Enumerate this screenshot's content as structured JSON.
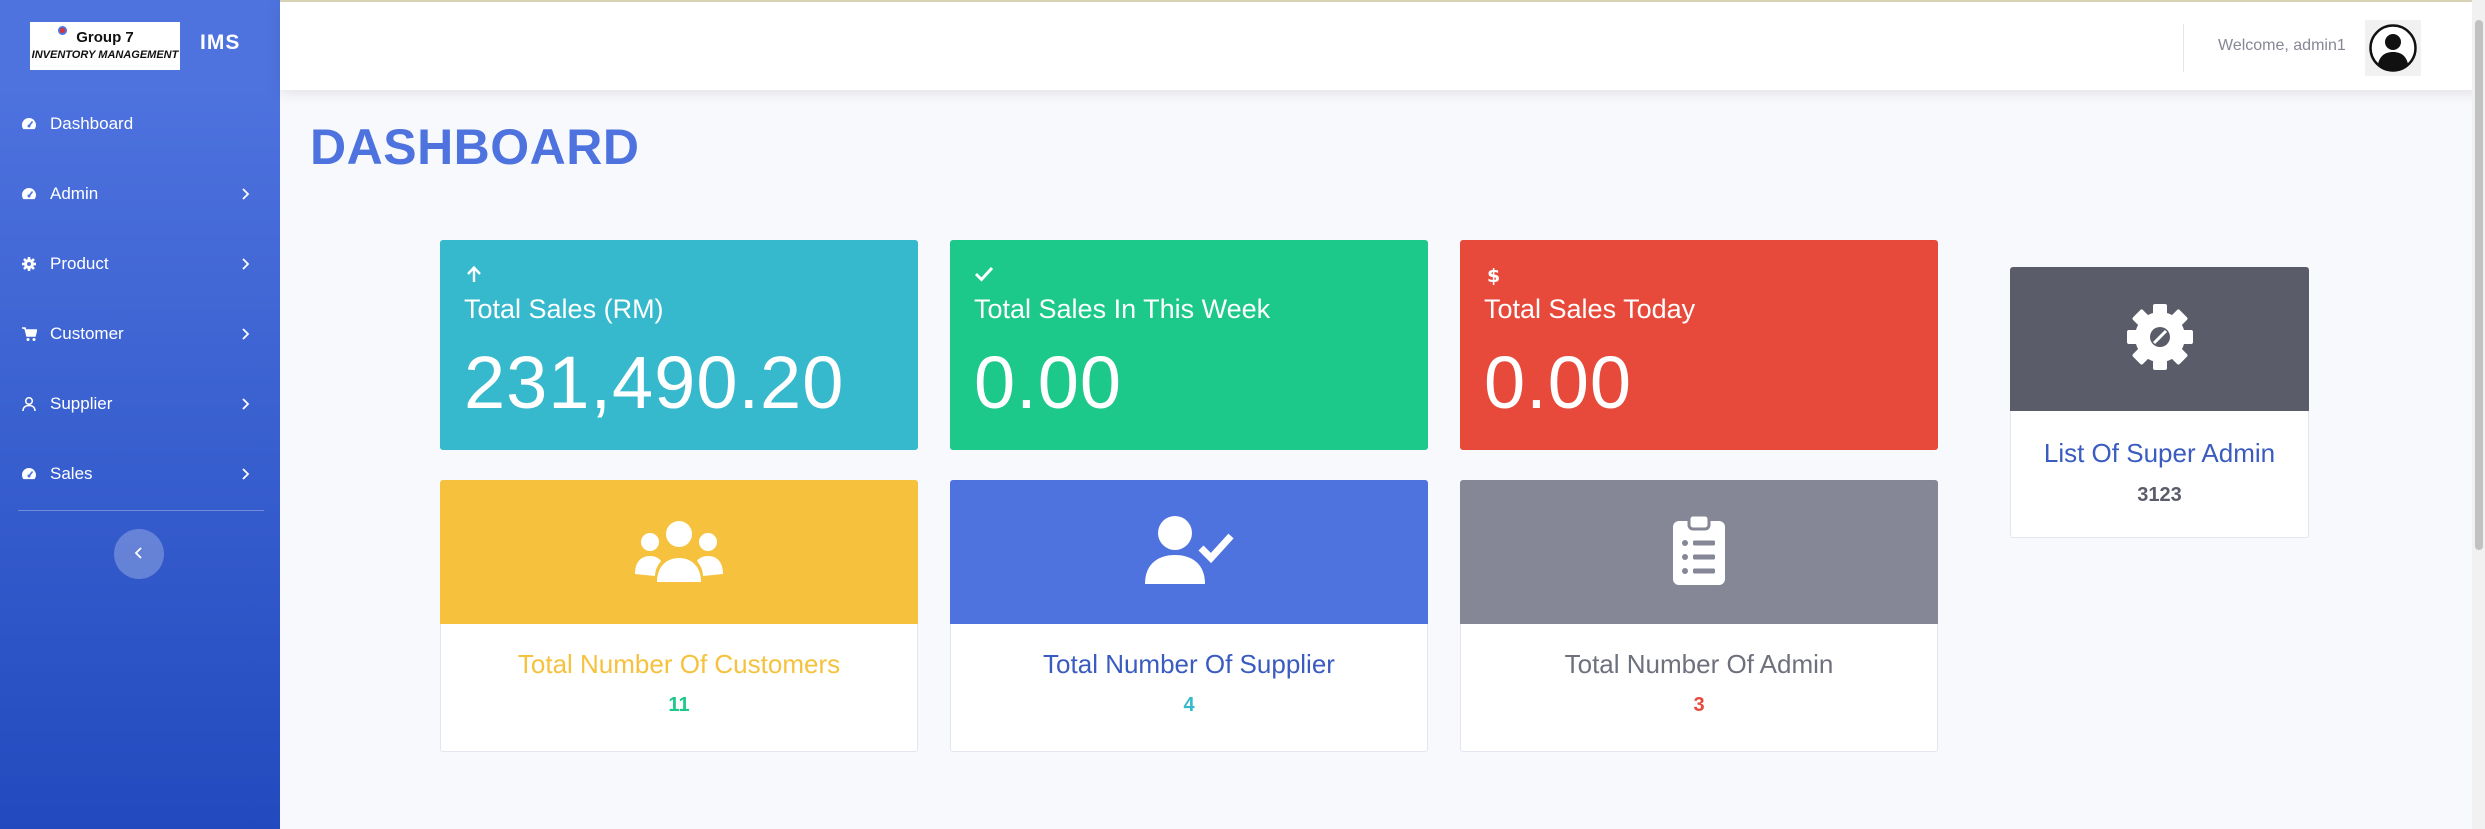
{
  "brand": {
    "logo_line1": "Group 7",
    "logo_line2": "INVENTORY MANAGEMENT",
    "app_name": "IMS"
  },
  "sidebar": {
    "items": [
      {
        "label": "Dashboard",
        "icon": "tachometer-icon"
      },
      {
        "label": "Admin",
        "icon": "tachometer-icon"
      },
      {
        "label": "Product",
        "icon": "gear-icon"
      },
      {
        "label": "Customer",
        "icon": "cart-icon"
      },
      {
        "label": "Supplier",
        "icon": "user-icon"
      },
      {
        "label": "Sales",
        "icon": "tachometer-icon"
      }
    ],
    "toggle_icon": "chevron-left-icon"
  },
  "topbar": {
    "welcome": "Welcome, admin1"
  },
  "page": {
    "title": "DASHBOARD"
  },
  "stats": [
    {
      "label": "Total Sales (RM)",
      "value": "231,490.20",
      "icon": "arrow-up-icon",
      "color": "#36b9cc"
    },
    {
      "label": "Total Sales In This Week",
      "value": "0.00",
      "icon": "check-icon",
      "color": "#1cc88a"
    },
    {
      "label": "Total Sales Today",
      "value": "0.00",
      "icon": "dollar-icon",
      "color": "#e74a3b"
    }
  ],
  "cards": [
    {
      "title": "Total Number Of Customers",
      "value": "11",
      "icon": "users-icon",
      "head_color": "#f6c23e",
      "title_color": "#f6c23e",
      "value_color": "#1cc88a"
    },
    {
      "title": "Total Number Of Supplier",
      "value": "4",
      "icon": "user-check-icon",
      "head_color": "#4e73df",
      "title_color": "#3a5bbf",
      "value_color": "#36b9cc"
    },
    {
      "title": "Total Number Of Admin",
      "value": "3",
      "icon": "clipboard-list-icon",
      "head_color": "#858796",
      "title_color": "#6e707e",
      "value_color": "#e74a3b"
    },
    {
      "title": "List Of Super Admin",
      "value": "3123",
      "icon": "gear-icon",
      "head_color": "#5a5c69",
      "title_color": "#3a5bbf",
      "value_color": "#5a5c69"
    }
  ]
}
